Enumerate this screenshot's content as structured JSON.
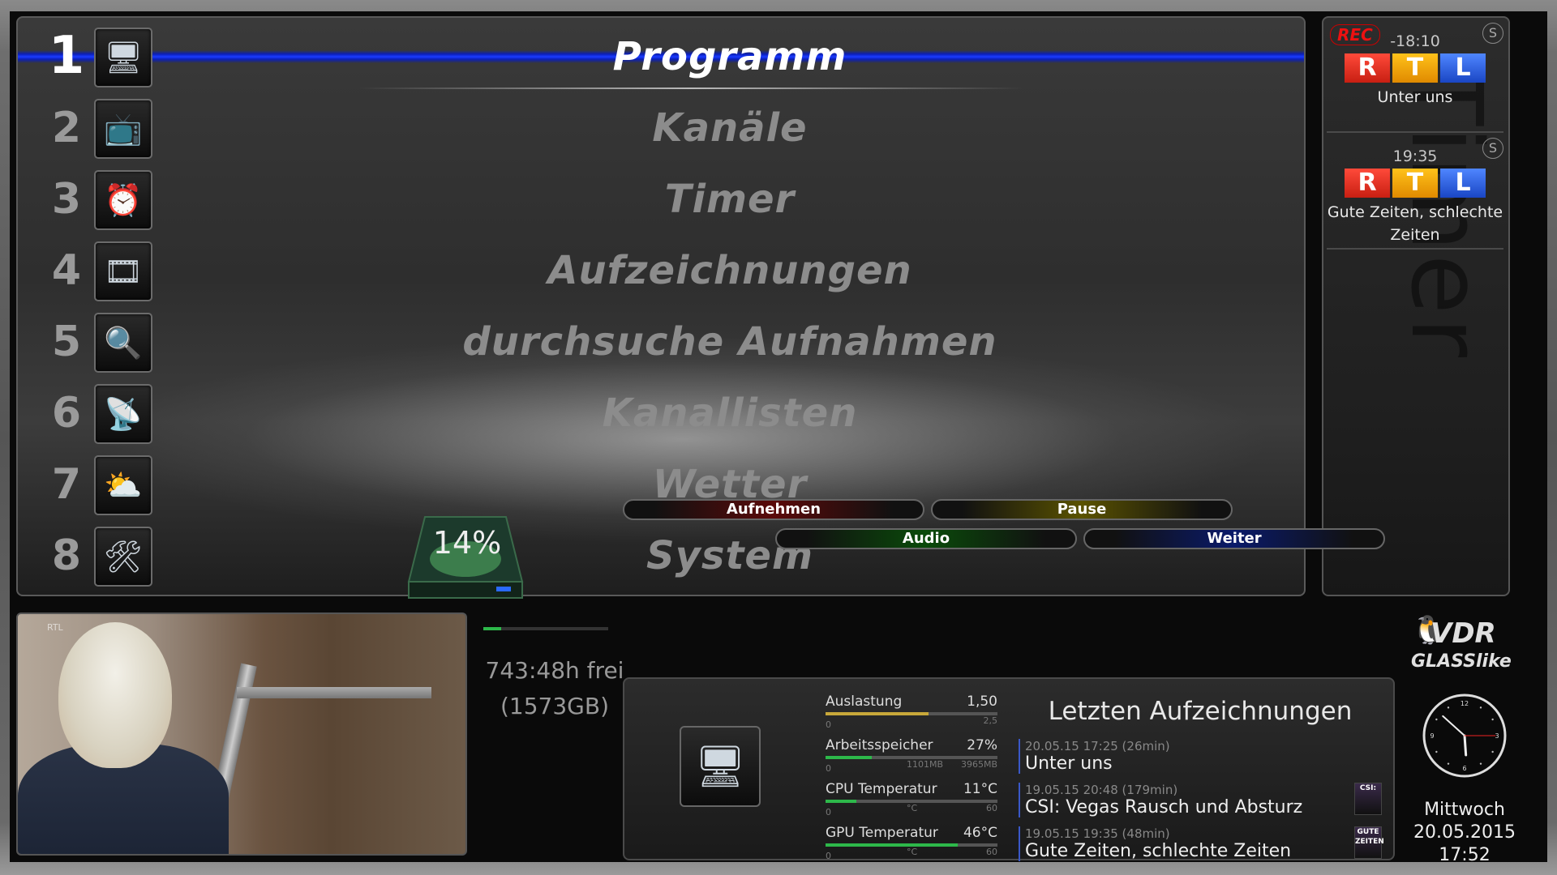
{
  "menu": {
    "items": [
      {
        "num": "1",
        "label": "Programm",
        "icon": "tv-search-icon",
        "glyph": "🖥"
      },
      {
        "num": "2",
        "label": "Kanäle",
        "icon": "channels-icon",
        "glyph": "📺"
      },
      {
        "num": "3",
        "label": "Timer",
        "icon": "alarm-clock-icon",
        "glyph": "⏰"
      },
      {
        "num": "4",
        "label": "Aufzeichnungen",
        "icon": "film-reel-icon",
        "glyph": "🎞"
      },
      {
        "num": "5",
        "label": "durchsuche Aufnahmen",
        "icon": "magnifier-icon",
        "glyph": "🔍"
      },
      {
        "num": "6",
        "label": "Kanallisten",
        "icon": "satellite-dish-icon",
        "glyph": "📡"
      },
      {
        "num": "7",
        "label": "Wetter",
        "icon": "weather-sun-cloud-icon",
        "glyph": "⛅"
      },
      {
        "num": "8",
        "label": "System",
        "icon": "drill-tools-icon",
        "glyph": "🛠"
      }
    ],
    "selected_index": 0
  },
  "timers": {
    "watermark": "Timer",
    "entries": [
      {
        "rec": "REC",
        "time": "-18:10",
        "channel_logo": [
          "R",
          "T",
          "L"
        ],
        "title": "Unter uns",
        "badge": "S"
      },
      {
        "rec": "",
        "time": "19:35",
        "channel_logo": [
          "R",
          "T",
          "L"
        ],
        "title": "Gute Zeiten, schlechte Zeiten",
        "badge": "S"
      }
    ]
  },
  "tv_preview": {
    "watermark": "RTL"
  },
  "disk": {
    "percent": "14%",
    "used_fraction": 0.14,
    "free_line1": "743:48h frei",
    "free_line2": "(1573GB)"
  },
  "buttons": {
    "red": "Aufnehmen",
    "yellow": "Pause",
    "green": "Audio",
    "blue": "Weiter"
  },
  "stats": [
    {
      "label": "Auslastung",
      "value": "1,50",
      "min": "0",
      "unit": "",
      "max": "2,5",
      "fraction": 0.6,
      "color": "#c8a83a"
    },
    {
      "label": "Arbeitsspeicher",
      "value": "27%",
      "min": "0",
      "unit": "1101MB",
      "max": "3965MB",
      "fraction": 0.27,
      "color": "#2db84a"
    },
    {
      "label": "CPU Temperatur",
      "value": "11°C",
      "min": "0",
      "unit": "°C",
      "max": "60",
      "fraction": 0.18,
      "color": "#2db84a"
    },
    {
      "label": "GPU Temperatur",
      "value": "46°C",
      "min": "0",
      "unit": "°C",
      "max": "60",
      "fraction": 0.77,
      "color": "#2db84a"
    }
  ],
  "recordings": {
    "title": "Letzten Aufzeichnungen",
    "items": [
      {
        "meta": "20.05.15    17:25    (26min)",
        "name": "Unter uns",
        "thumb": ""
      },
      {
        "meta": "19.05.15    20:48    (179min)",
        "name": "CSI: Vegas Rausch und Absturz",
        "thumb": "CSI:"
      },
      {
        "meta": "19.05.15    19:35    (48min)",
        "name": "Gute Zeiten, schlechte Zeiten",
        "thumb": "GUTE ZEITEN"
      }
    ]
  },
  "logo": {
    "line1": "VDR",
    "line2": "GLASSlike"
  },
  "clock": {
    "hour": 17,
    "minute": 52,
    "second": 15
  },
  "datetime": {
    "weekday": "Mittwoch",
    "date": "20.05.2015",
    "time": "17:52"
  }
}
